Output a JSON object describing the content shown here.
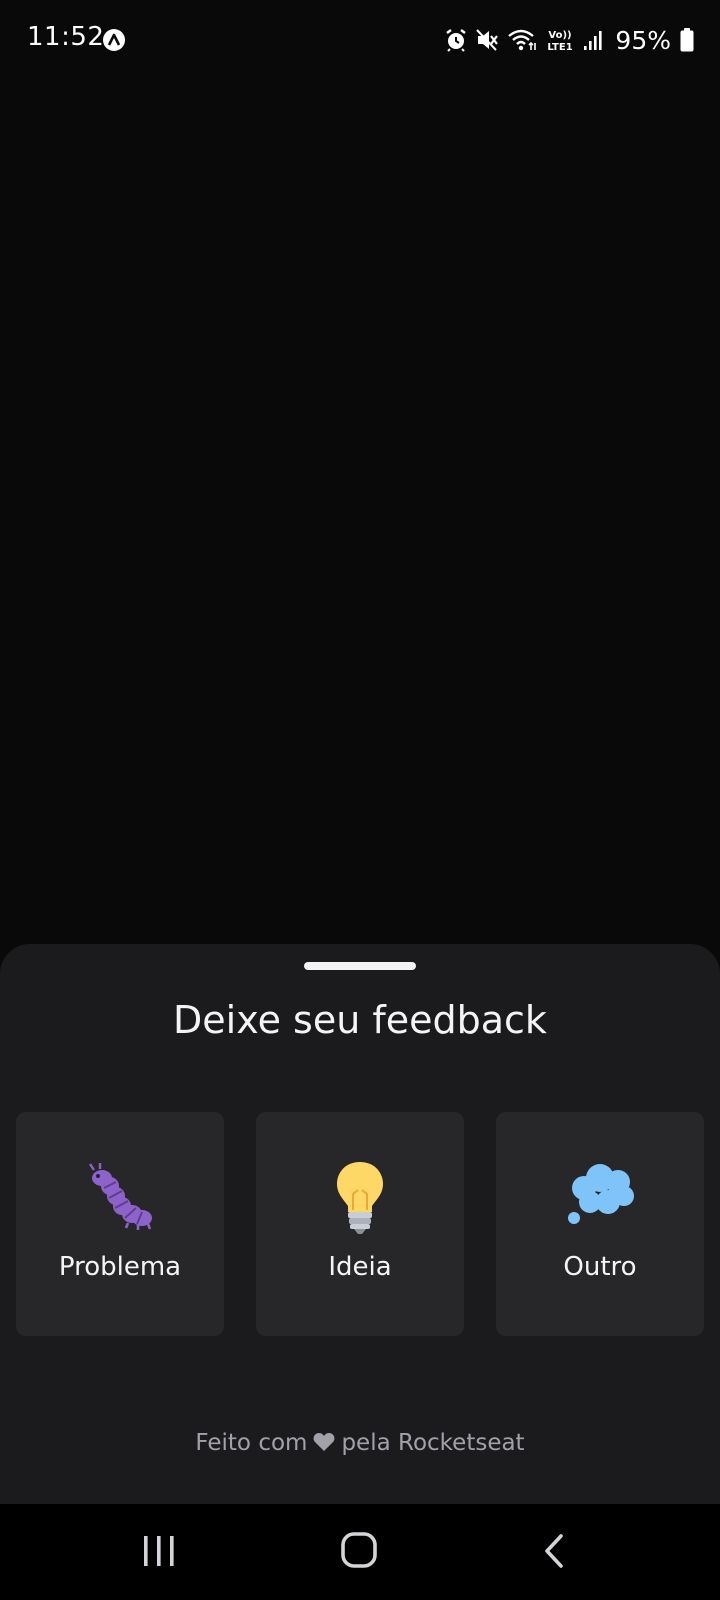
{
  "status_bar": {
    "time": "11:52",
    "battery": "95%",
    "network_label": "Vo) LTE1",
    "icons": [
      "app-notification-icon",
      "alarm-icon",
      "mute-icon",
      "wifi-icon",
      "volte-icon",
      "signal-icon",
      "battery-icon"
    ]
  },
  "sheet": {
    "title": "Deixe seu feedback",
    "options": [
      {
        "label": "Problema",
        "icon": "bug-icon"
      },
      {
        "label": "Ideia",
        "icon": "lightbulb-icon"
      },
      {
        "label": "Outro",
        "icon": "thought-bubble-icon"
      }
    ],
    "footer_before": "Feito com",
    "footer_after": "pela Rocketseat",
    "footer_icon": "heart-icon"
  },
  "colors": {
    "background": "#09090a",
    "sheet": "#1b1b1e",
    "card": "#27272a",
    "text": "#f4f4f5",
    "muted_text": "#a1a1aa",
    "bug": "#8e63c9",
    "lightbulb": "#fdd866",
    "thought": "#7fc4f8"
  },
  "nav_bar": {
    "buttons": [
      "recents-icon",
      "home-icon",
      "back-icon"
    ]
  }
}
